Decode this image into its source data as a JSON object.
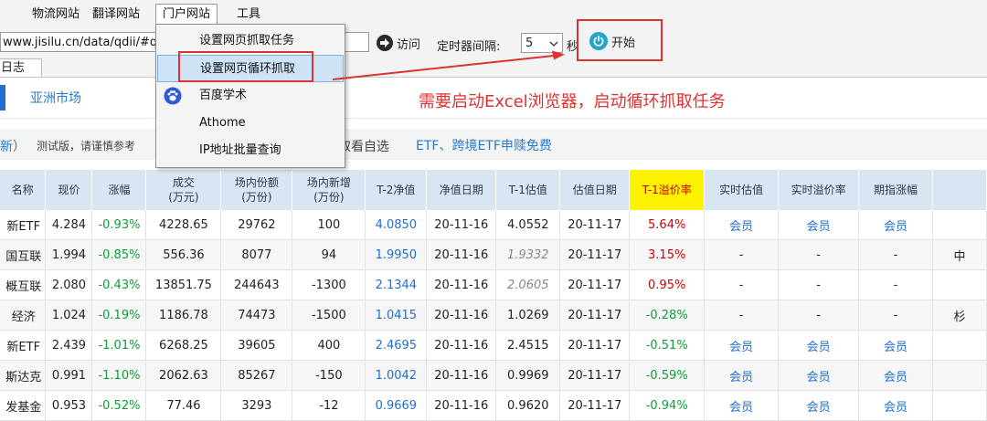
{
  "menubar": {
    "items": [
      "物流网站",
      "翻译网站",
      "门户网站",
      "工具"
    ]
  },
  "toolbar": {
    "url_value": "www.jisilu.cn/data/qdii/#qdiia",
    "visit_label": "访问",
    "timer_label": "定时器间隔:",
    "timer_value": "5",
    "seconds_label": "秒",
    "start_label": "开始"
  },
  "tabs": {
    "log_label": "日志"
  },
  "dropdown": {
    "items": [
      "设置网页抓取任务",
      "设置网页循环抓取",
      "百度学术",
      "Athome",
      "IP地址批量查询"
    ],
    "selected_index": 1
  },
  "annotation": "需要启动Excel浏览器，启动循环抓取任务",
  "page": {
    "market": "亚洲市场",
    "notice_link": "新）",
    "notice_text": "测试版，请谨慎参考",
    "notice_mid": "取看自选",
    "notice_promo": "ETF、跨境ETF申赎免费"
  },
  "table": {
    "headers": [
      "名称",
      "现价",
      "涨幅",
      "成交\n(万元)",
      "场内份额\n(万份)",
      "场内新增\n(万份)",
      "T-2净值",
      "净值日期",
      "T-1估值",
      "估值日期",
      "T-1溢价率",
      "实时估值",
      "实时溢价率",
      "期指涨幅",
      ""
    ],
    "rows": [
      [
        "新ETF",
        "4.284",
        "-0.93%",
        "4228.65",
        "29762",
        "100",
        "4.0850",
        "20-11-16",
        "4.0552",
        "20-11-17",
        "5.64%",
        "会员",
        "会员",
        "会员",
        ""
      ],
      [
        "国互联",
        "1.994",
        "-0.85%",
        "556.36",
        "8077",
        "94",
        "1.9950",
        "20-11-16",
        "1.9332",
        "20-11-17",
        "3.15%",
        "-",
        "-",
        "-",
        "中"
      ],
      [
        "概互联",
        "2.080",
        "-0.43%",
        "13851.75",
        "244643",
        "-1300",
        "2.1344",
        "20-11-16",
        "2.0605",
        "20-11-17",
        "0.95%",
        "-",
        "-",
        "-",
        ""
      ],
      [
        "经济",
        "1.024",
        "-0.19%",
        "1186.78",
        "74473",
        "-1500",
        "1.0415",
        "20-11-16",
        "1.0269",
        "20-11-17",
        "-0.28%",
        "-",
        "-",
        "-",
        "杉"
      ],
      [
        "新ETF",
        "2.439",
        "-1.01%",
        "6268.25",
        "39605",
        "400",
        "2.4695",
        "20-11-16",
        "2.4515",
        "20-11-17",
        "-0.51%",
        "会员",
        "会员",
        "会员",
        ""
      ],
      [
        "斯达克",
        "0.991",
        "-1.10%",
        "2062.63",
        "85267",
        "-150",
        "1.0042",
        "20-11-16",
        "0.9969",
        "20-11-17",
        "-0.59%",
        "会员",
        "会员",
        "会员",
        ""
      ],
      [
        "发基金",
        "0.953",
        "-0.52%",
        "77.46",
        "3293",
        "-12",
        "0.9669",
        "20-11-16",
        "0.9620",
        "20-11-17",
        "-0.94%",
        "会员",
        "会员",
        "会员",
        ""
      ]
    ]
  },
  "colors": {
    "accent_blue": "#1f6fd0",
    "annotation_red": "#e03131",
    "highlight_yellow": "#fff200",
    "gain_red": "#d10000",
    "loss_green": "#0f9d3a"
  }
}
